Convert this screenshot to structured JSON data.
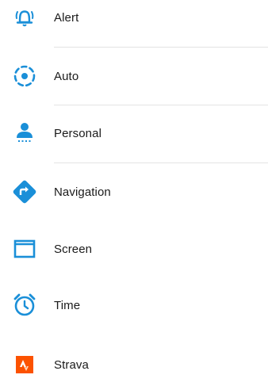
{
  "items": [
    {
      "label": "Alert",
      "icon": "alarm-bell-icon",
      "color": "#1a8fd8"
    },
    {
      "label": "Auto",
      "icon": "auto-target-icon",
      "color": "#1a8fd8"
    },
    {
      "label": "Personal",
      "icon": "person-icon",
      "color": "#1a8fd8"
    },
    {
      "label": "Navigation",
      "icon": "navigation-arrow-icon",
      "color": "#1a8fd8"
    },
    {
      "label": "Screen",
      "icon": "screen-icon",
      "color": "#1a8fd8"
    },
    {
      "label": "Time",
      "icon": "alarm-clock-icon",
      "color": "#1a8fd8"
    },
    {
      "label": "Strava",
      "icon": "strava-logo-icon",
      "color": "#fc5200"
    }
  ]
}
